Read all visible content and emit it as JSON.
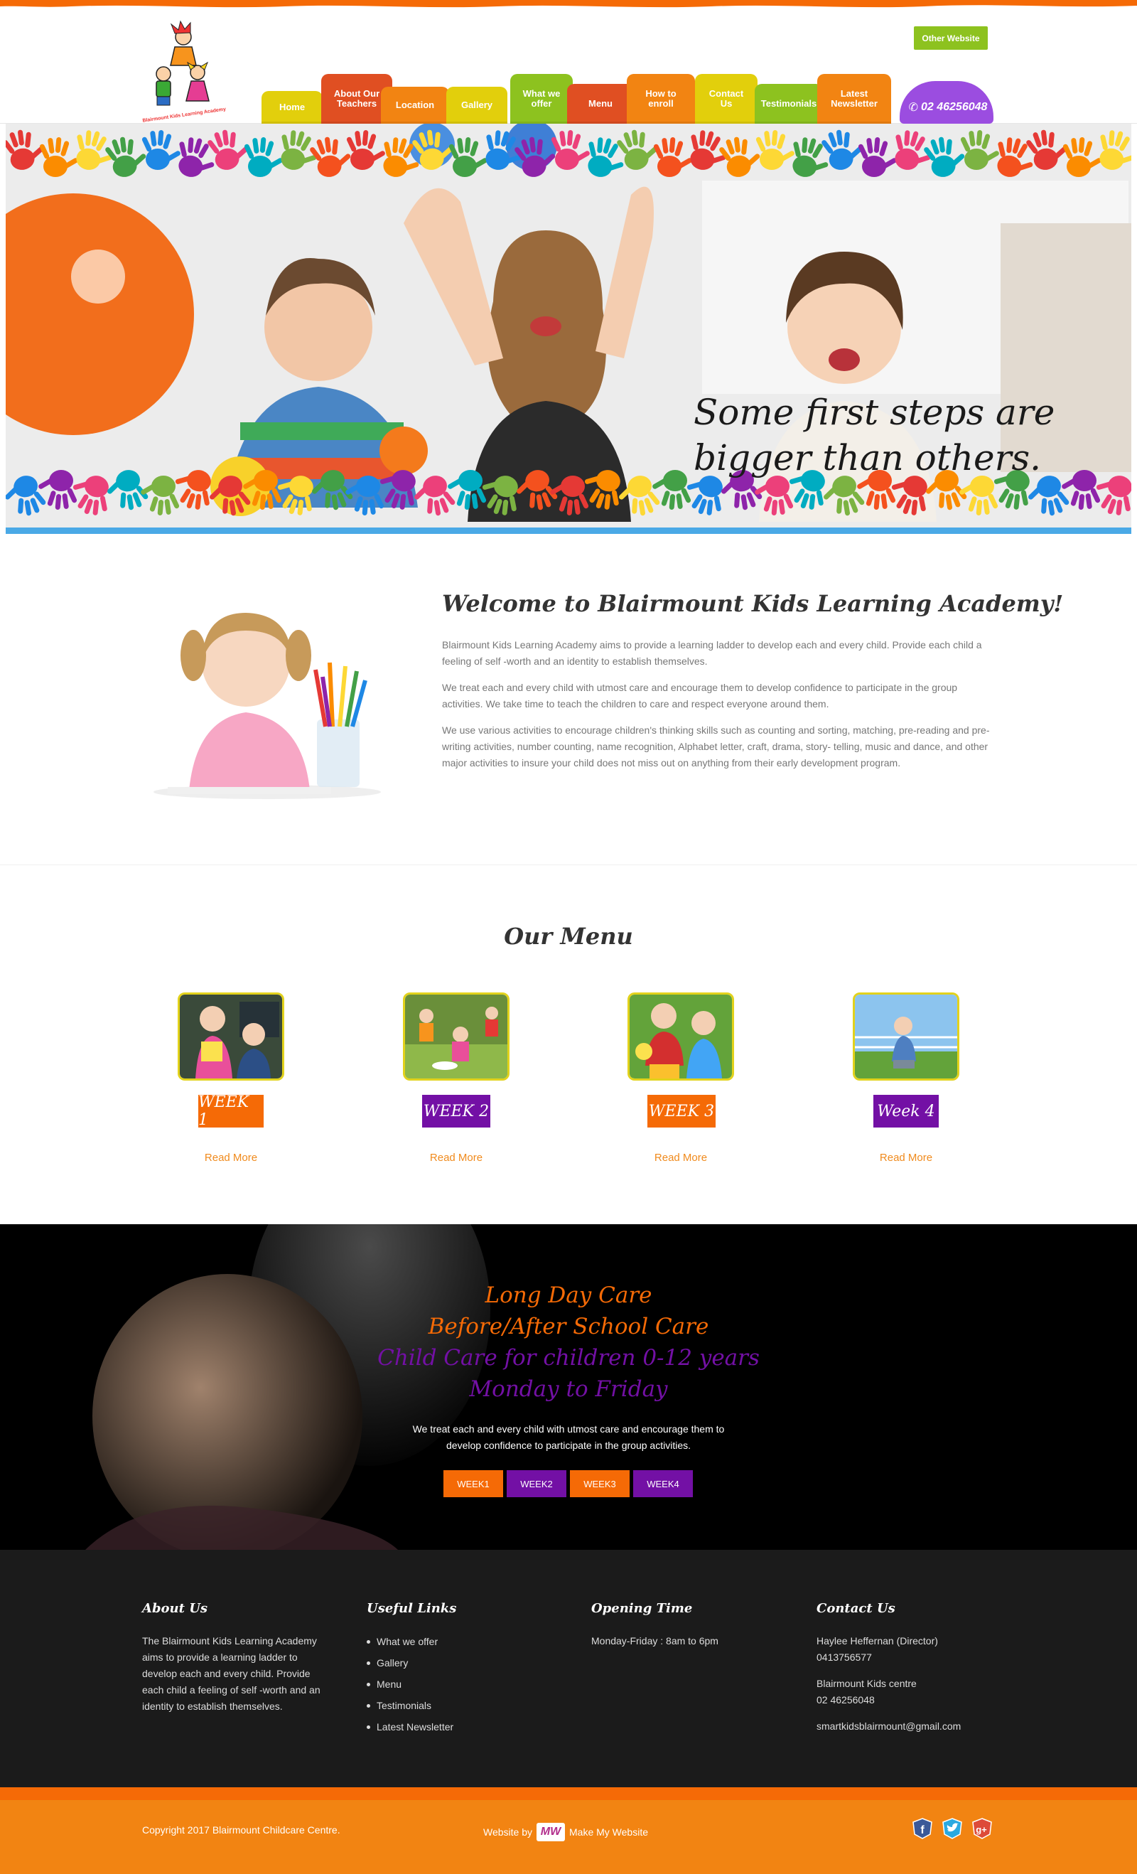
{
  "header": {
    "logo_text": "Blairmount Kids Learning Academy",
    "other_website": "Other Website",
    "phone": "02 46256048",
    "nav": [
      {
        "label": "Home",
        "color": "#e2cf0c"
      },
      {
        "label": "About Our Teachers",
        "color": "#e04f22"
      },
      {
        "label": "Location",
        "color": "#f28412"
      },
      {
        "label": "Gallery",
        "color": "#e2cf0c"
      },
      {
        "label": "What we offer",
        "color": "#8dc21f"
      },
      {
        "label": "Menu",
        "color": "#e04f22"
      },
      {
        "label": "How to enroll",
        "color": "#f28412"
      },
      {
        "label": "Contact Us",
        "color": "#e2cf0c"
      },
      {
        "label": "Testimonials",
        "color": "#8dc21f"
      },
      {
        "label": "Latest Newsletter",
        "color": "#f28412"
      }
    ]
  },
  "hero": {
    "caption_line1": "Some first steps are",
    "caption_line2": "bigger than others."
  },
  "welcome": {
    "title": "Welcome to Blairmount Kids Learning Academy!",
    "p1": "Blairmount Kids Learning Academy aims to provide a learning ladder to develop each and every child. Provide each child a feeling of self -worth and an identity to establish themselves.",
    "p2": "We treat each and every child with utmost care and encourage them to develop confidence to participate in the group activities. We take time to teach the children to care and respect everyone around them.",
    "p3": "We use various activities to encourage children's thinking skills such as counting and sorting, matching, pre-reading and pre-writing activities, number counting, name recognition, Alphabet letter, craft, drama, story- telling, music and dance, and other major activities to insure your child does not miss out on anything from their early development program."
  },
  "menu": {
    "title": "Our Menu",
    "weeks": [
      {
        "label": "WEEK 1",
        "color": "#f56a06",
        "read_more": "Read More"
      },
      {
        "label": "WEEK 2",
        "color": "#7310a5",
        "read_more": "Read More"
      },
      {
        "label": "WEEK 3",
        "color": "#f56a06",
        "read_more": "Read More"
      },
      {
        "label": "Week 4",
        "color": "#7310a5",
        "read_more": "Read More"
      }
    ]
  },
  "care": {
    "line1": "Long Day Care",
    "line2": "Before/After School Care",
    "line3": "Child Care for children 0-12 years",
    "line4": "Monday to Friday",
    "text": "We treat each and every child with utmost care and encourage them to develop confidence to participate in the group activities.",
    "buttons": [
      {
        "label": "WEEK1",
        "color": "#f56a06"
      },
      {
        "label": "WEEK2",
        "color": "#7310a5"
      },
      {
        "label": "WEEK3",
        "color": "#f56a06"
      },
      {
        "label": "WEEK4",
        "color": "#7310a5"
      }
    ],
    "orange": "#f56a06",
    "purple": "#7310a5"
  },
  "footer": {
    "about_title": "About Us",
    "about_text": "The Blairmount Kids Learning Academy aims to provide a learning ladder to develop each and every child. Provide each child a feeling of self -worth and an identity to establish themselves.",
    "links_title": "Useful Links",
    "links": [
      "What we offer",
      "Gallery",
      "Menu",
      "Testimonials",
      "Latest Newsletter"
    ],
    "opening_title": "Opening Time",
    "opening_text": "Monday-Friday : 8am to 6pm",
    "contact_title": "Contact Us",
    "contact_name": "Haylee Heffernan (Director)",
    "contact_mobile": "0413756577",
    "centre_name": "Blairmount Kids centre",
    "centre_phone": "02 46256048",
    "email": "smartkidsblairmount@gmail.com"
  },
  "copyright": {
    "text": "Copyright 2017 Blairmount Childcare Centre.",
    "website_by": "Website by",
    "mw_logo": "MW",
    "maker": "Make My Website",
    "social": [
      "facebook-icon",
      "twitter-icon",
      "google-plus-icon"
    ]
  }
}
